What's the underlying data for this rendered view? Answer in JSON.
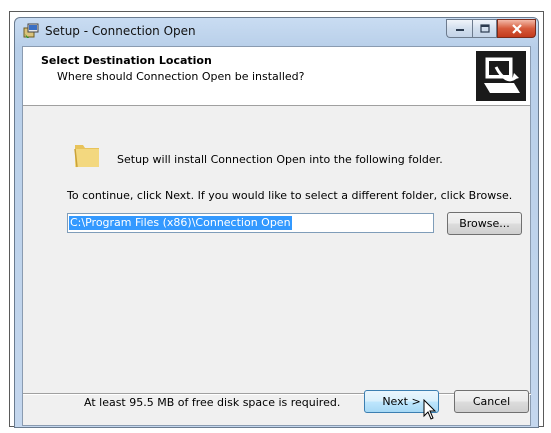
{
  "window": {
    "title": "Setup - Connection Open",
    "icon": "setup-installer-icon",
    "controls": {
      "minimize": "minimize-icon",
      "maximize": "maximize-icon",
      "close": "close-icon"
    }
  },
  "header": {
    "title": "Select Destination Location",
    "subtitle": "Where should Connection Open be installed?",
    "icon": "computer-install-icon"
  },
  "body": {
    "install_message": "Setup will install Connection Open into the following folder.",
    "continue_message": "To continue, click Next. If you would like to select a different folder, click Browse.",
    "path_value": "C:\\Program Files (x86)\\Connection Open",
    "browse_label": "Browse...",
    "disk_space_message": "At least 95.5 MB of free disk space is required."
  },
  "footer": {
    "next_label": "Next >",
    "cancel_label": "Cancel"
  },
  "colors": {
    "selection": "#3399ff",
    "titlebar": "#c4d7ee",
    "close_button": "#c33a1c"
  }
}
